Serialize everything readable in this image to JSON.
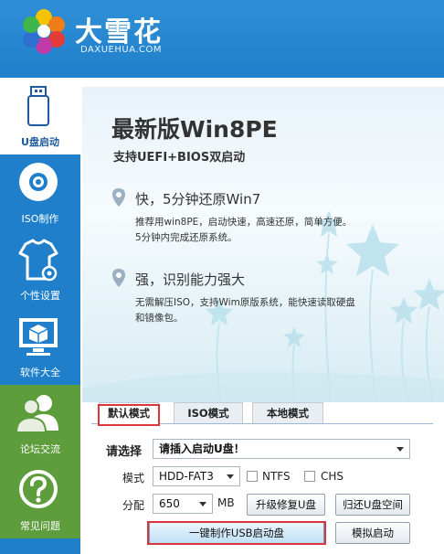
{
  "brand": {
    "name_cn": "大雪花",
    "domain": "DAXUEHUA.COM"
  },
  "sidebar": {
    "items": [
      {
        "label": "U盘启动",
        "icon": "usb-drive-icon"
      },
      {
        "label": "ISO制作",
        "icon": "disc-icon"
      },
      {
        "label": "个性设置",
        "icon": "tshirt-gear-icon"
      },
      {
        "label": "软件大全",
        "icon": "box-monitor-icon"
      },
      {
        "label": "论坛交流",
        "icon": "users-icon"
      },
      {
        "label": "常见问题",
        "icon": "question-icon"
      }
    ]
  },
  "banner": {
    "title": "最新版Win8PE",
    "subtitle": "支持UEFI+BIOS双启动",
    "features": [
      {
        "title": "快，5分钟还原Win7",
        "desc_lines": [
          "推荐用win8PE，启动快速，高速还原，简单方便。",
          "5分钟内完成还原系统。"
        ]
      },
      {
        "title": "强，识别能力强大",
        "desc_lines": [
          "无需解压ISO，支持Wim原版系统，能快速读取硬盘",
          "和镜像包。"
        ]
      }
    ]
  },
  "tabs": [
    "默认模式",
    "ISO模式",
    "本地模式"
  ],
  "form": {
    "select_label": "请选择",
    "disk_select": "请插入启动U盘！",
    "mode_label": "模式",
    "mode_value": "HDD-FAT3",
    "ntfs_label": "NTFS",
    "chs_label": "CHS",
    "alloc_label": "分配",
    "alloc_value": "650",
    "alloc_unit": "MB",
    "repair_button": "升级修复U盘",
    "restore_button": "归还U盘空间",
    "make_button": "一键制作USB启动盘",
    "simulate_button": "模拟启动"
  },
  "colors": {
    "primary_blue": "#1f7fca",
    "green": "#5d9d3c",
    "highlight_red": "#d9363e"
  }
}
